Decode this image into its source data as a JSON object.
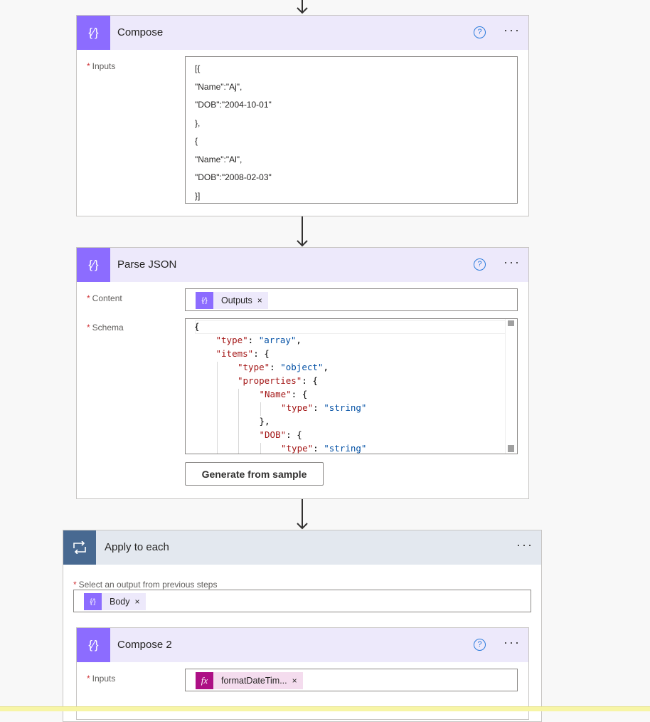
{
  "compose": {
    "title": "Compose",
    "inputs_label": "Inputs",
    "inputs_lines": [
      "[{",
      "\"Name\":\"Aj\",",
      "\"DOB\":\"2004-10-01\"",
      "},",
      "{",
      "\"Name\":\"Al\",",
      "\"DOB\":\"2008-02-03\"",
      "}]"
    ]
  },
  "parse_json": {
    "title": "Parse JSON",
    "content_label": "Content",
    "content_chip": "Outputs",
    "schema_label": "Schema",
    "schema_lines": [
      {
        "indent": 0,
        "key": "",
        "val": "",
        "text": "{"
      },
      {
        "indent": 1,
        "key": "\"type\"",
        "val": "\"array\"",
        "text": ","
      },
      {
        "indent": 1,
        "key": "\"items\"",
        "val": "",
        "text": "{"
      },
      {
        "indent": 2,
        "key": "\"type\"",
        "val": "\"object\"",
        "text": ","
      },
      {
        "indent": 2,
        "key": "\"properties\"",
        "val": "",
        "text": "{"
      },
      {
        "indent": 3,
        "key": "\"Name\"",
        "val": "",
        "text": "{"
      },
      {
        "indent": 4,
        "key": "\"type\"",
        "val": "\"string\"",
        "text": ""
      },
      {
        "indent": 3,
        "key": "",
        "val": "",
        "text": "},"
      },
      {
        "indent": 3,
        "key": "\"DOB\"",
        "val": "",
        "text": "{"
      },
      {
        "indent": 4,
        "key": "\"type\"",
        "val": "\"string\"",
        "text": ""
      }
    ],
    "generate_button": "Generate from sample"
  },
  "apply_to_each": {
    "title": "Apply to each",
    "select_label": "Select an output from previous steps",
    "select_chip": "Body"
  },
  "compose2": {
    "title": "Compose 2",
    "inputs_label": "Inputs",
    "inputs_chip": "formatDateTim...",
    "chip_icon": "fx"
  },
  "required_mark": "*",
  "help_glyph": "?",
  "more_glyph": "···",
  "remove_glyph": "×",
  "colors": {
    "action_purple": "#8c6cff",
    "header_lavender": "#ede9fb",
    "loop_blue": "#4a6583",
    "expression_magenta": "#ad0f85"
  }
}
